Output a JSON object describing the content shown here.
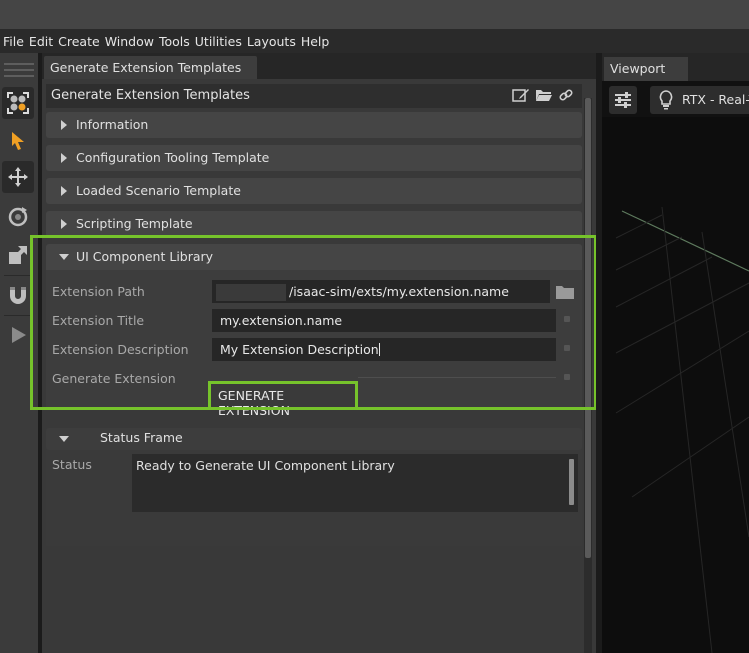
{
  "menubar": {
    "items": [
      "File",
      "Edit",
      "Create",
      "Window",
      "Tools",
      "Utilities",
      "Layouts",
      "Help"
    ]
  },
  "toolbar": {
    "tools": [
      "select-icon",
      "move-icon",
      "rotate-icon",
      "scale-icon",
      "snap-magnet-icon",
      "play-icon"
    ]
  },
  "panel": {
    "tab_label": "Generate Extension Templates",
    "header_title": "Generate Extension Templates",
    "header_icons": [
      "edit-icon",
      "folder-open-icon",
      "link-icon"
    ],
    "sections": [
      {
        "label": "Information",
        "expanded": false
      },
      {
        "label": "Configuration Tooling Template",
        "expanded": false
      },
      {
        "label": "Loaded Scenario Template",
        "expanded": false
      },
      {
        "label": "Scripting Template",
        "expanded": false
      }
    ],
    "ui_component": {
      "label": "UI Component Library",
      "expanded": true,
      "extension_path_label": "Extension Path",
      "extension_path_value": "/isaac-sim/exts/my.extension.name",
      "extension_title_label": "Extension Title",
      "extension_title_value": "my.extension.name",
      "extension_description_label": "Extension Description",
      "extension_description_value": "My Extension Description",
      "generate_label": "Generate Extension",
      "generate_button": "GENERATE EXTENSION"
    },
    "status_frame": {
      "label": "Status Frame",
      "status_label": "Status",
      "status_text": "Ready to Generate UI Component Library"
    }
  },
  "viewport": {
    "tab_label": "Viewport",
    "renderer_label": "RTX - Real-T"
  },
  "colors": {
    "highlight_green": "#76c32b",
    "accent_orange": "#f0a024"
  }
}
